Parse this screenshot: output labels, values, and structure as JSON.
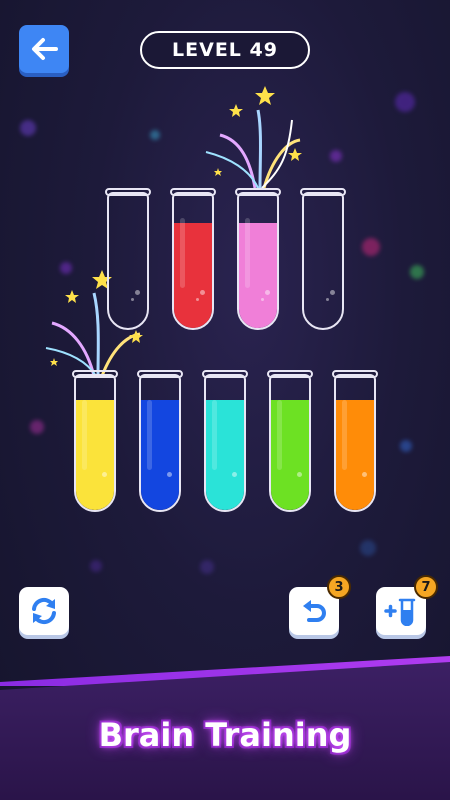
{
  "header": {
    "level_label": "LEVEL 49",
    "back_icon": "arrow-left-icon"
  },
  "tubes": {
    "row1": [
      {
        "color": "",
        "fill": 0
      },
      {
        "color": "#e8323c",
        "fill": 0.78
      },
      {
        "color": "#f07fd8",
        "fill": 0.78
      },
      {
        "color": "",
        "fill": 0
      }
    ],
    "row2": [
      {
        "color": "#fbe33a",
        "fill": 0.82
      },
      {
        "color": "#1346e0",
        "fill": 0.82
      },
      {
        "color": "#2ae3d8",
        "fill": 0.82
      },
      {
        "color": "#6de123",
        "fill": 0.82
      },
      {
        "color": "#ff8c08",
        "fill": 0.82
      }
    ]
  },
  "tools": {
    "restart_icon": "restart-icon",
    "undo_icon": "undo-icon",
    "undo_count": "3",
    "add_tube_icon": "add-tube-icon",
    "add_tube_count": "7"
  },
  "footer": {
    "caption": "Brain Training"
  },
  "colors": {
    "accent_blue": "#3e86f4",
    "badge_orange": "#f5a623",
    "footer_purple": "#2a1449"
  }
}
